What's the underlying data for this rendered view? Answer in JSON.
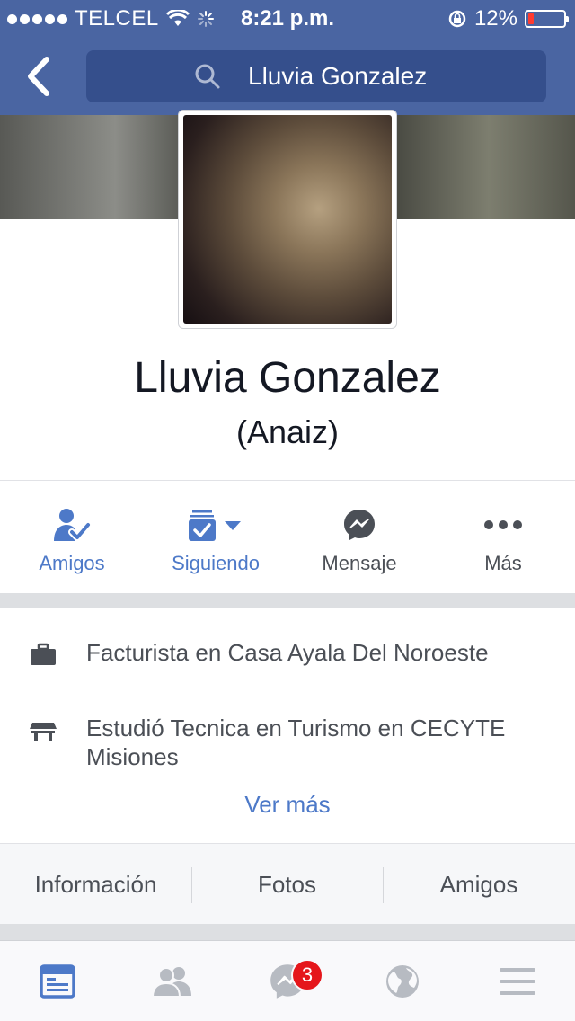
{
  "status_bar": {
    "carrier": "TELCEL",
    "time": "8:21 p.m.",
    "battery": "12%",
    "battery_level": 0.12
  },
  "header": {
    "search_text": "Lluvia Gonzalez"
  },
  "profile": {
    "name": "Lluvia Gonzalez",
    "alternate_name": "(Anaiz)"
  },
  "actions": [
    {
      "label": "Amigos",
      "icon": "friends-check-icon"
    },
    {
      "label": "Siguiendo",
      "icon": "following-icon"
    },
    {
      "label": "Mensaje",
      "icon": "messenger-icon"
    },
    {
      "label": "Más",
      "icon": "more-dots-icon"
    }
  ],
  "info": [
    {
      "icon": "briefcase-icon",
      "text": "Facturista en Casa Ayala Del Noroeste"
    },
    {
      "icon": "school-icon",
      "text": "Estudió Tecnica en Turismo en CECYTE Misiones"
    }
  ],
  "see_more": "Ver más",
  "tabs": [
    {
      "label": "Información"
    },
    {
      "label": "Fotos"
    },
    {
      "label": "Amigos"
    }
  ],
  "bottom_nav": {
    "messenger_badge": "3",
    "items": [
      "news-feed-icon",
      "friends-icon",
      "messenger-icon",
      "globe-icon",
      "menu-icon"
    ]
  },
  "colors": {
    "header": "#4a65a2",
    "search_bg": "#354f8c",
    "link_blue": "#4d79c8",
    "text_dark": "#141823",
    "text_grey": "#4b4f56",
    "badge_red": "#e5161b"
  }
}
